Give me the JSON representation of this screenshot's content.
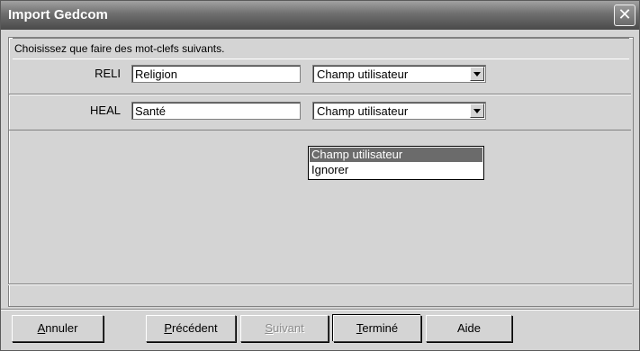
{
  "window": {
    "title": "Import Gedcom",
    "close_glyph": "✕"
  },
  "instruction": "Choisissez que faire des mot-clefs suivants.",
  "rows": [
    {
      "tag": "RELI",
      "value": "Religion",
      "combo": "Champ utilisateur"
    },
    {
      "tag": "HEAL",
      "value": "Santé",
      "combo": "Champ utilisateur"
    }
  ],
  "dropdown": {
    "options": [
      "Champ utilisateur",
      "Ignorer"
    ],
    "selected": "Champ utilisateur"
  },
  "buttons": {
    "cancel": {
      "pre": "",
      "u": "A",
      "post": "nnuler"
    },
    "previous": {
      "pre": "",
      "u": "P",
      "post": "récédent"
    },
    "next": {
      "pre": "",
      "u": "S",
      "post": "uivant"
    },
    "finish": {
      "pre": "",
      "u": "T",
      "post": "erminé"
    },
    "help": {
      "label": "Aide"
    }
  },
  "colors": {
    "titlebar": "#6e6e6e",
    "selection": "#6b6b6b",
    "face": "#d4d4d4"
  }
}
